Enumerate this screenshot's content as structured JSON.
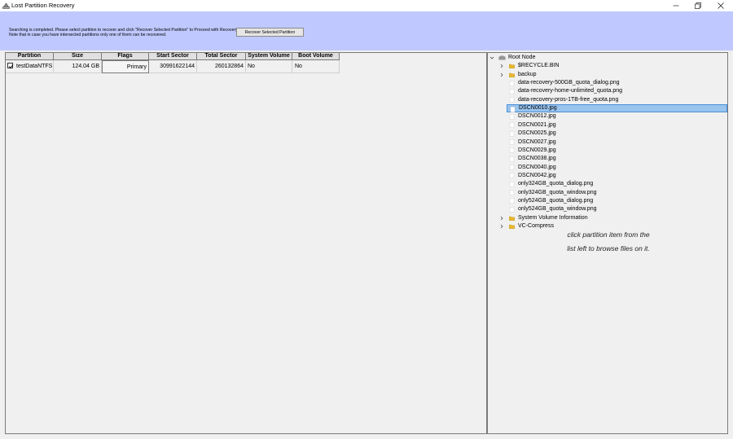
{
  "window": {
    "title": "Lost Partition Recovery",
    "icons": {
      "app": "disk-icon",
      "minimize": "minimize-icon",
      "maximize": "maximize-icon",
      "close": "close-icon"
    }
  },
  "header": {
    "info_line1": "Searching is completed. Please select partition to recover and click \"Recover Selected Partition\" to Proceed with Recovery.",
    "info_line2": "Note that in case you have intersected partitions only one of them can be recovered.",
    "recover_button": "Recover Selected Partition"
  },
  "partition_table": {
    "columns": [
      "Partition",
      "Size",
      "Flags",
      "Start Sector",
      "Total Sector",
      "System Volume",
      "Boot Volume"
    ],
    "rows": [
      {
        "checked": true,
        "partition": "testDataNTFS",
        "size": "124.04 GB",
        "flags": "Primary",
        "start_sector": "30991622144",
        "total_sector": "260132864",
        "system_volume": "No",
        "boot_volume": "No"
      }
    ]
  },
  "tree": {
    "root": "Root Node",
    "items": [
      {
        "label": "$RECYCLE.BIN",
        "type": "folder",
        "expandable": true
      },
      {
        "label": "backup",
        "type": "folder",
        "expandable": true
      },
      {
        "label": "data-recovery-500GB_quota_dialog.png",
        "type": "file",
        "expandable": false
      },
      {
        "label": "data-recovery-home-unlimited_quota.png",
        "type": "file",
        "expandable": false
      },
      {
        "label": "data-recovery-pros-1TB-free_quota.png",
        "type": "file",
        "expandable": false
      },
      {
        "label": "DSCN0010.jpg",
        "type": "file",
        "expandable": false,
        "selected": true
      },
      {
        "label": "DSCN0012.jpg",
        "type": "file",
        "expandable": false
      },
      {
        "label": "DSCN0021.jpg",
        "type": "file",
        "expandable": false
      },
      {
        "label": "DSCN0025.jpg",
        "type": "file",
        "expandable": false
      },
      {
        "label": "DSCN0027.jpg",
        "type": "file",
        "expandable": false
      },
      {
        "label": "DSCN0029.jpg",
        "type": "file",
        "expandable": false
      },
      {
        "label": "DSCN0038.jpg",
        "type": "file",
        "expandable": false
      },
      {
        "label": "DSCN0040.jpg",
        "type": "file",
        "expandable": false
      },
      {
        "label": "DSCN0042.jpg",
        "type": "file",
        "expandable": false
      },
      {
        "label": "only324GB_quota_dialog.png",
        "type": "file",
        "expandable": false
      },
      {
        "label": "only324GB_quota_window.png",
        "type": "file",
        "expandable": false
      },
      {
        "label": "only524GB_quota_dialog.png",
        "type": "file",
        "expandable": false
      },
      {
        "label": "only524GB_quota_window.png",
        "type": "file",
        "expandable": false
      },
      {
        "label": "System Volume Information",
        "type": "folder",
        "expandable": true
      },
      {
        "label": "VC-Compress",
        "type": "folder",
        "expandable": true
      }
    ]
  },
  "hint": {
    "line1": "click partition item from the",
    "line2": "list left to browse files on it."
  },
  "colors": {
    "header_bg": "#bfc9ff",
    "panel_bg": "#f0f0f0",
    "selection": "#99c4ee",
    "folder": "#e8b830"
  }
}
